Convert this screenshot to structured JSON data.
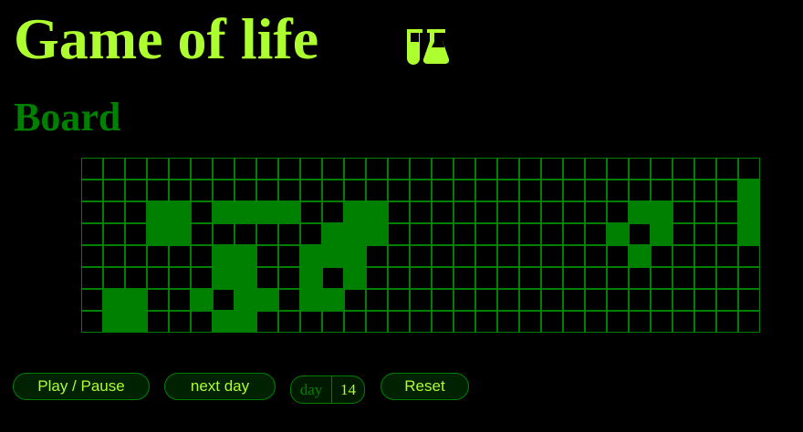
{
  "header": {
    "title": "Game of life",
    "icon": "flask-icon"
  },
  "board": {
    "heading": "Board",
    "cols": 31,
    "rows": 8,
    "alive_color": "#008000",
    "dead_color": "#000000",
    "grid_color": "#008000",
    "cells": [
      "...............................",
      "..............................#",
      "...##.####..##...........##...#",
      "...##......###..........#.#...#",
      "......##..###............#.....",
      "......##..#.#..................",
      ".##..#.##.##...................",
      ".##...##......................."
    ]
  },
  "controls": {
    "play_pause_label": "Play / Pause",
    "next_day_label": "next day",
    "day_label": "day",
    "day_value": "14",
    "reset_label": "Reset"
  },
  "colors": {
    "title": "#adff2f",
    "heading": "#008000",
    "background": "#000000"
  }
}
